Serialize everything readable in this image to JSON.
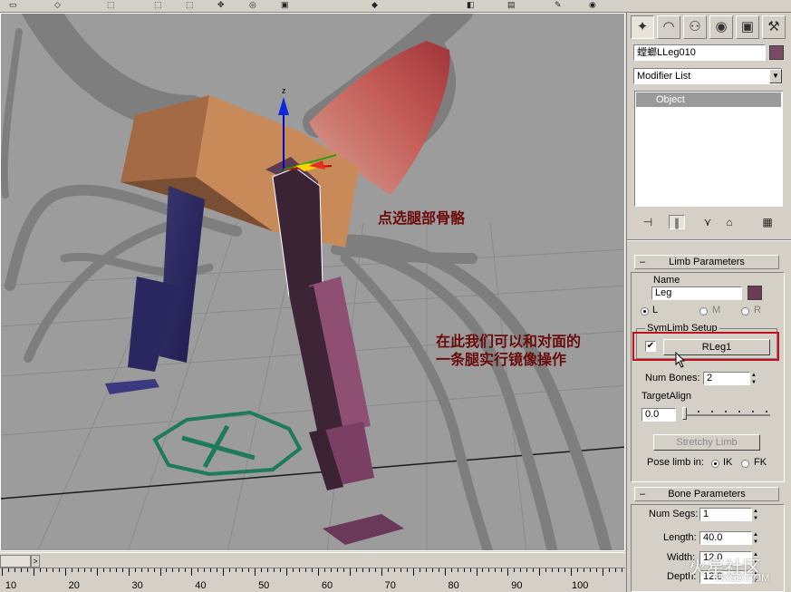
{
  "viewport": {
    "annotations": {
      "select_leg": "点选腿部骨骼",
      "mirror_line1": "在此我们可以和对面的",
      "mirror_line2": "一条腿实行镜像操作"
    },
    "gizmo_axis_label": "z"
  },
  "timeline": {
    "ticks": [
      "10",
      "20",
      "30",
      "40",
      "50",
      "60",
      "70",
      "80",
      "90",
      "100"
    ],
    "nav_glyph": ">"
  },
  "panel": {
    "object_name": "螳螂LLeg010",
    "object_color": "#7a4a66",
    "modifier_list_label": "Modifier List",
    "stack_item": "Object",
    "limb": {
      "header": "Limb Parameters",
      "name_label": "Name",
      "name_value": "Leg",
      "name_color": "#6e3a56",
      "side_options": [
        "L",
        "M",
        "R"
      ],
      "side_selected": "L",
      "sym_group_label": "SymLimb Setup",
      "sym_checked": true,
      "sym_button": "RLeg1",
      "num_bones_label": "Num Bones:",
      "num_bones_value": "2",
      "target_align_label": "TargetAlign",
      "target_align_value": "0.0",
      "stretchy_button": "Stretchy Limb",
      "pose_label": "Pose limb in:",
      "pose_options": [
        "IK",
        "FK"
      ],
      "pose_selected": "IK"
    },
    "bone": {
      "header": "Bone Parameters",
      "num_segs_label": "Num Segs:",
      "num_segs_value": "1",
      "length_label": "Length:",
      "length_value": "40.0",
      "width_label": "Width:",
      "width_value": "12.0",
      "depth_label": "Depth:",
      "depth_value": "12.0"
    }
  },
  "watermark": {
    "brand": "火星社区",
    "site": "HXSD.COM"
  },
  "colors": {
    "highlight": "#c0101a",
    "annotation": "#6b0a0a",
    "viewport_bg": "#9c9c9c"
  }
}
